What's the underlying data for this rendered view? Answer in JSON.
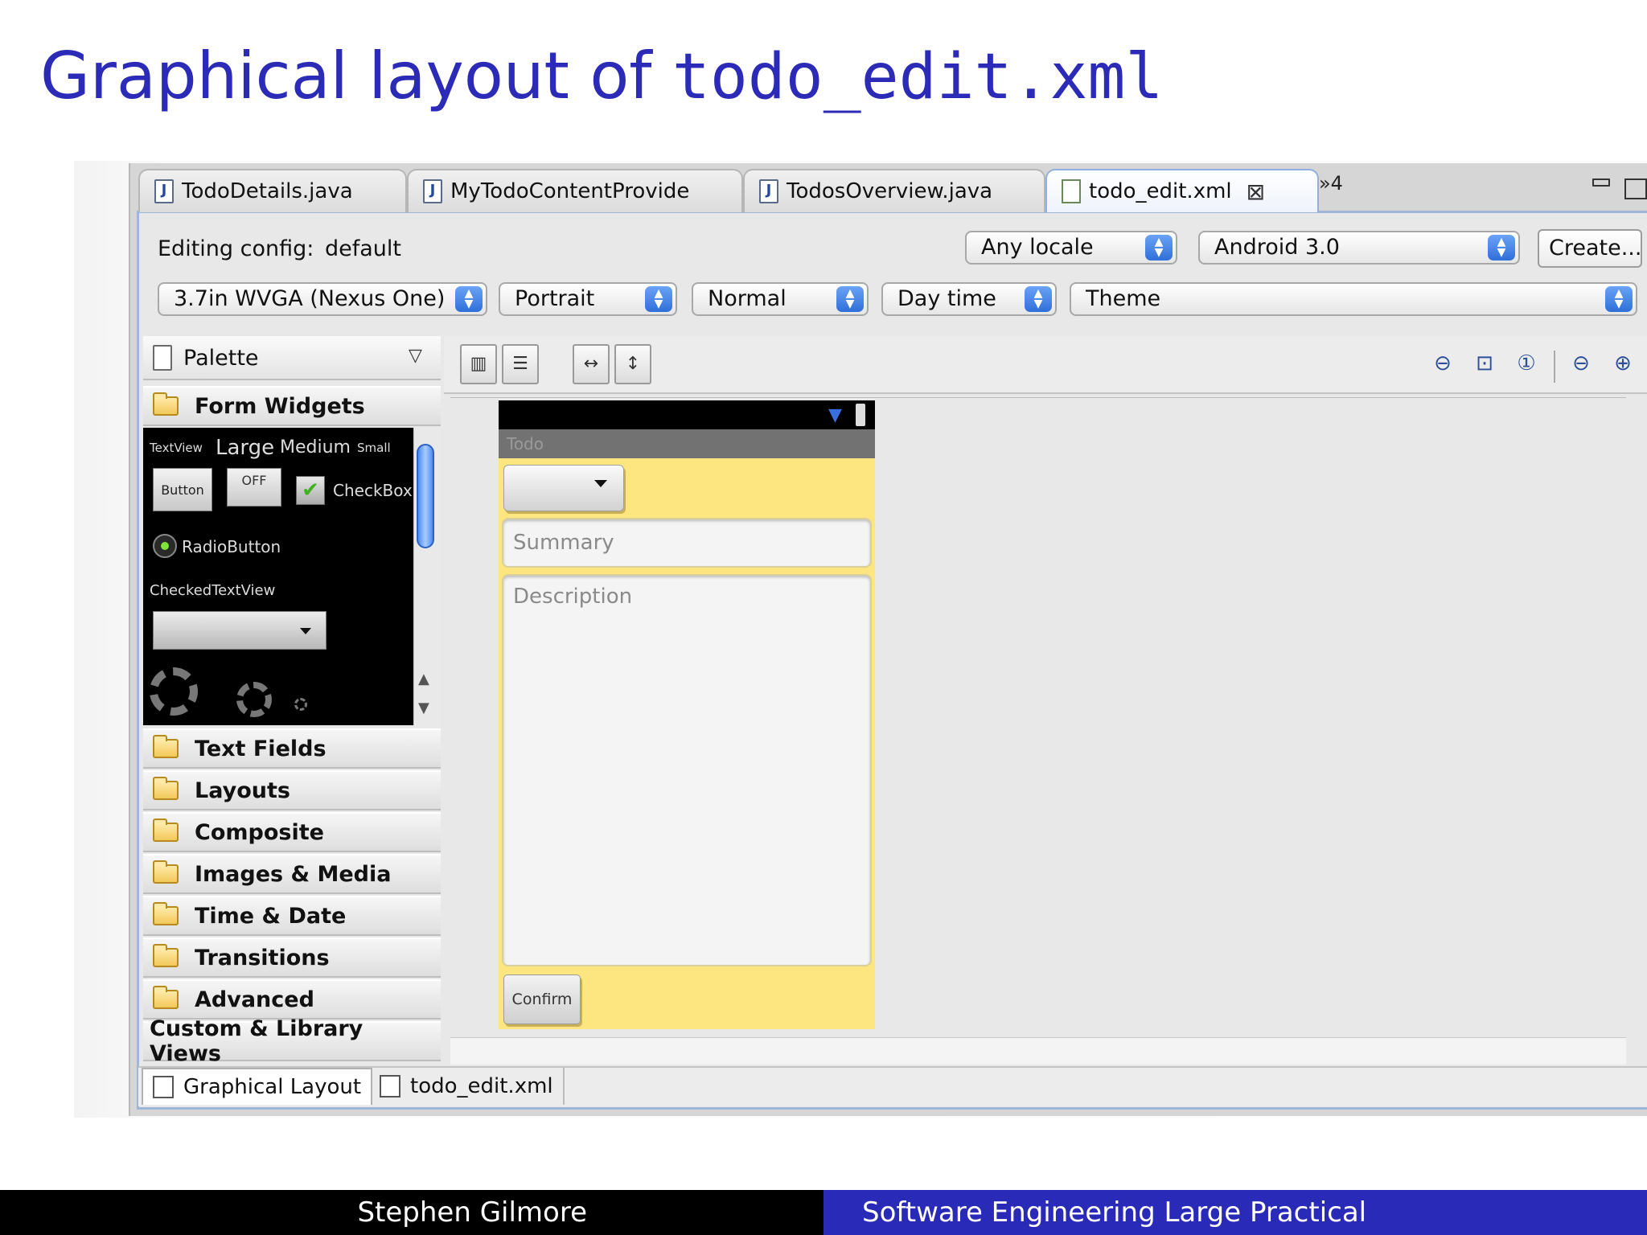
{
  "slide": {
    "title_prefix": "Graphical layout of ",
    "title_code": "todo_edit.xml",
    "footer_author": "Stephen Gilmore",
    "footer_course": "Software Engineering Large Practical"
  },
  "editor_tabs": [
    {
      "label": "TodoDetails.java",
      "icon": "java-file-icon"
    },
    {
      "label": "MyTodoContentProvide",
      "icon": "java-file-icon"
    },
    {
      "label": "TodosOverview.java",
      "icon": "java-file-icon"
    },
    {
      "label": "todo_edit.xml",
      "icon": "xml-file-icon",
      "active": true
    }
  ],
  "more_tabs_label": "»4",
  "config": {
    "editing_label": "Editing config:",
    "editing_value": "default",
    "locale": "Any locale",
    "android_version": "Android 3.0",
    "create_button": "Create...",
    "device": "3.7in WVGA (Nexus One)",
    "orientation": "Portrait",
    "density": "Normal",
    "time": "Day time",
    "theme": "Theme"
  },
  "palette": {
    "title": "Palette",
    "open_category": "Form Widgets",
    "preview": {
      "textview": "TextView",
      "large": "Large",
      "medium": "Medium",
      "small": "Small",
      "button": "Button",
      "toggle": "OFF",
      "checkbox": "CheckBox",
      "radio": "RadioButton",
      "checked_text": "CheckedTextView"
    },
    "categories": [
      "Text Fields",
      "Layouts",
      "Composite",
      "Images & Media",
      "Time & Date",
      "Transitions",
      "Advanced"
    ],
    "custom_views": "Custom & Library Views"
  },
  "phone": {
    "app_title": "Todo",
    "summary_hint": "Summary",
    "description_hint": "Description",
    "confirm_label": "Confirm"
  },
  "bottom_tabs": {
    "graphical": "Graphical Layout",
    "xml": "todo_edit.xml"
  },
  "colors": {
    "title_blue": "#2b2bb8",
    "footer_blue": "#2a2ab8",
    "phone_background": "#fde680"
  }
}
